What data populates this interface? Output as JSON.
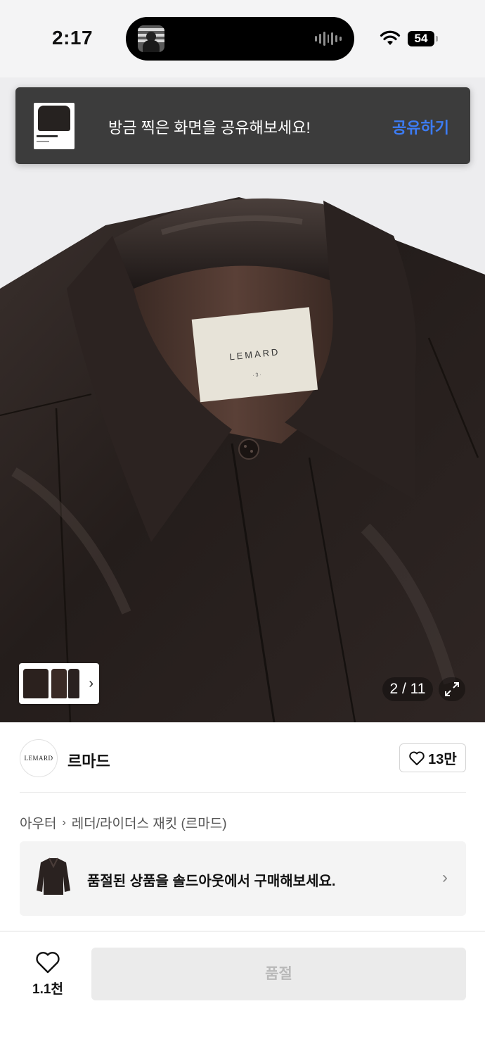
{
  "status_bar": {
    "time": "2:17",
    "battery": "54"
  },
  "toast": {
    "message": "방금 찍은 화면을 공유해보세요!",
    "action": "공유하기"
  },
  "product_image": {
    "label_text": "LEMARD",
    "label_sub": "· 3 ·",
    "counter": "2 / 11"
  },
  "brand": {
    "logo_text": "LEMARD",
    "name": "르마드",
    "like_count": "13만"
  },
  "breadcrumb": {
    "category": "아우터",
    "subcategory": "레더/라이더스 재킷 (르마드)"
  },
  "soldout_banner": {
    "text": "품절된 상품을 솔드아웃에서 구매해보세요."
  },
  "bottom_bar": {
    "wish_count": "1.1천",
    "buy_button": "품절"
  },
  "colors": {
    "accent_blue": "#3c7cf5",
    "toast_bg": "#3c3c3c",
    "leather": "#2a2220"
  }
}
